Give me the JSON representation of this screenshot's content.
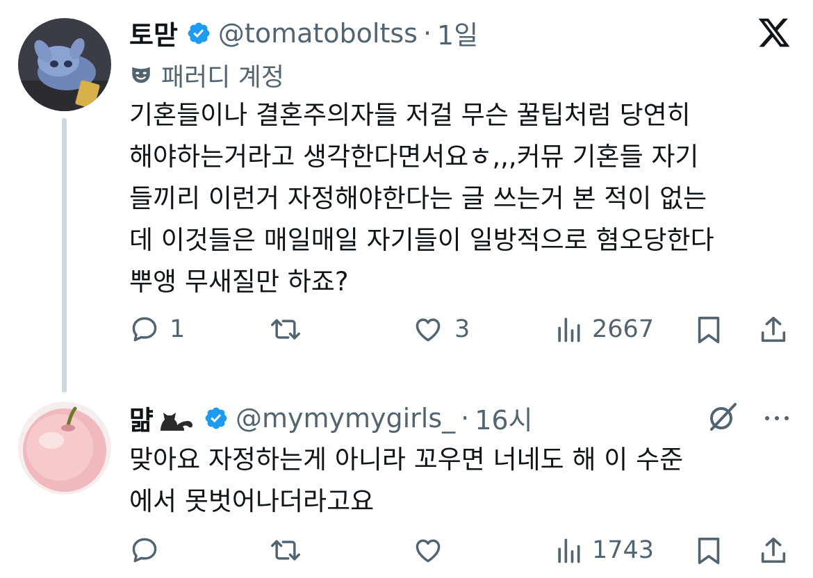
{
  "tweets": [
    {
      "name": "토맏",
      "handle": "@tomatoboltss",
      "time": "1일",
      "parody_label": "패러디 계정",
      "text": "기혼들이나 결혼주의자들 저걸 무슨 꿀팁처럼 당연히\n해야하는거라고 생각한다면서요ㅎ,,,커뮤 기혼들 자기\n들끼리 이런거 자정해야한다는 글 쓰는거 본 적이 없는\n데 이것들은 매일매일 자기들이 일방적으로 혐오당한다\n뿌앵 무새질만 하죠?",
      "replies": "1",
      "likes": "3",
      "views": "2667"
    },
    {
      "name": "먊",
      "handle": "@mymymygirls_",
      "time": "16시",
      "text": "맞아요 자정하는게 아니라 꼬우면 너네도 해 이 수준\n에서 못벗어나더라고요",
      "views": "1743"
    }
  ],
  "colors": {
    "text": "#0f1419",
    "secondary": "#536471",
    "verified": "#1d9bf0",
    "thread": "#cfd9de"
  }
}
